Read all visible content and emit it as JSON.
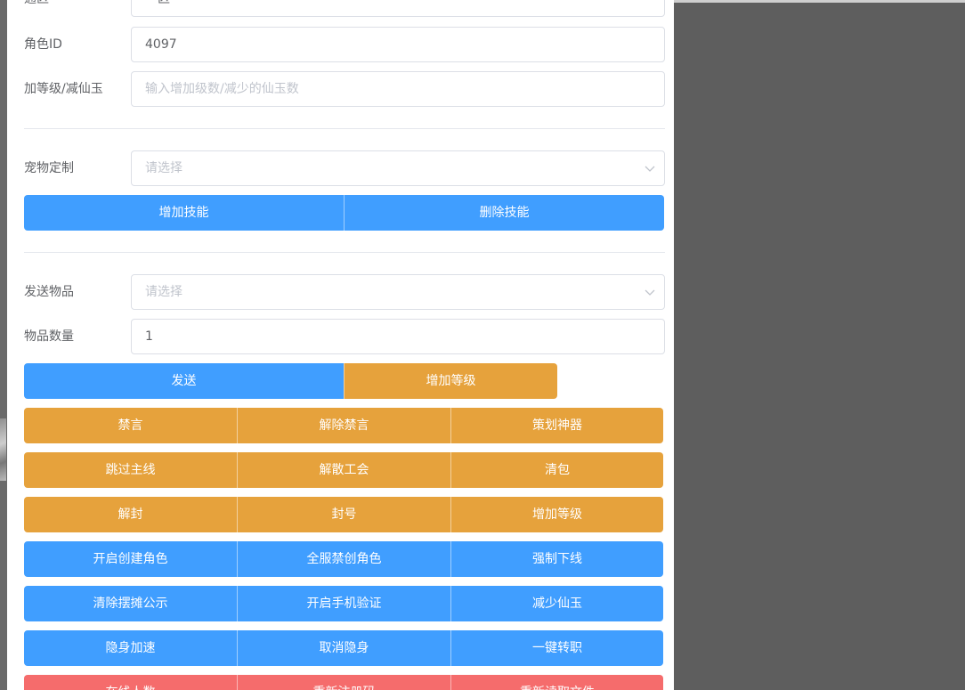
{
  "form": {
    "top_partial_label": "通区",
    "top_partial_value": "一区",
    "role_id_label": "角色ID",
    "role_id_value": "4097",
    "level_label": "加等级/减仙玉",
    "level_placeholder": "输入增加级数/减少的仙玉数",
    "pet_label": "宠物定制",
    "pet_placeholder": "请选择",
    "send_item_label": "发送物品",
    "send_item_placeholder": "请选择",
    "item_qty_label": "物品数量",
    "item_qty_value": "1"
  },
  "skill_buttons": [
    "增加技能",
    "删除技能"
  ],
  "send_buttons": [
    "发送",
    "增加等级"
  ],
  "action_rows": [
    {
      "color": "#e6a23c",
      "buttons": [
        "禁言",
        "解除禁言",
        "策划神器"
      ]
    },
    {
      "color": "#e6a23c",
      "buttons": [
        "跳过主线",
        "解散工会",
        "清包"
      ]
    },
    {
      "color": "#e6a23c",
      "buttons": [
        "解封",
        "封号",
        "增加等级"
      ]
    },
    {
      "color": "#409eff",
      "buttons": [
        "开启创建角色",
        "全服禁创角色",
        "强制下线"
      ]
    },
    {
      "color": "#409eff",
      "buttons": [
        "清除摆摊公示",
        "开启手机验证",
        "减少仙玉"
      ]
    },
    {
      "color": "#409eff",
      "buttons": [
        "隐身加速",
        "取消隐身",
        "一键转职"
      ]
    },
    {
      "color": "#f56c6c",
      "buttons": [
        "在线人数",
        "重新注册码",
        "重新读取文件"
      ]
    }
  ],
  "icons": {
    "select_arrow": "chevron-down-icon"
  }
}
